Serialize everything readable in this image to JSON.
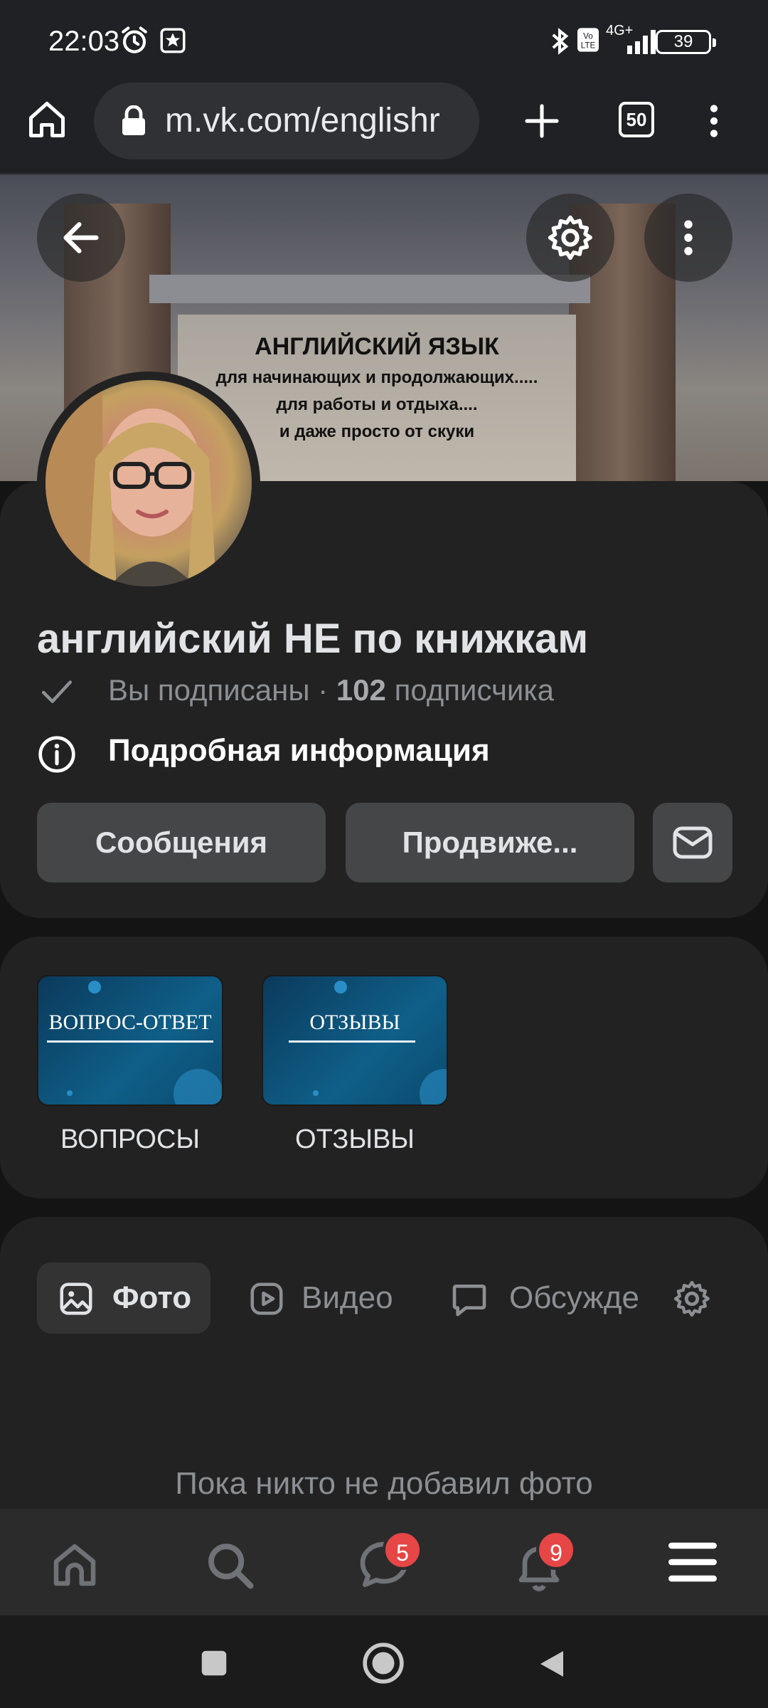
{
  "status_bar": {
    "time": "22:03",
    "network": "4G+",
    "battery": "39"
  },
  "browser": {
    "url": "m.vk.com/englishr",
    "tab_count": "50"
  },
  "cover": {
    "title": "АНГЛИЙСКИЙ ЯЗЫК",
    "lines": [
      "для начинающих и продолжающих.....",
      "для работы и отдыха....",
      "и даже просто от скуки"
    ]
  },
  "group": {
    "name": "английский НЕ по книжкам",
    "subscribed_text": "Вы подписаны ·",
    "subscribers_count": "102",
    "subscribers_label": "подписчика",
    "info_label": "Подробная информация"
  },
  "actions": {
    "messages": "Сообщения",
    "promote": "Продвиже..."
  },
  "albums": [
    {
      "cover_text": "ВОПРОС-ОТВЕТ",
      "label": "ВОПРОСЫ"
    },
    {
      "cover_text": "ОТЗЫВЫ",
      "label": "ОТЗЫВЫ"
    }
  ],
  "tabs": [
    {
      "label": "Фото",
      "icon": "photo-icon",
      "active": true
    },
    {
      "label": "Видео",
      "icon": "video-icon",
      "active": false
    },
    {
      "label": "Обсужде",
      "icon": "discussion-icon",
      "active": false
    }
  ],
  "empty_message": "Пока никто не добавил фото",
  "bottom_nav": {
    "messages_badge": "5",
    "notifications_badge": "9"
  },
  "colors": {
    "background": "#141414",
    "card": "#222222",
    "button": "#454647",
    "badge": "#e64646"
  }
}
